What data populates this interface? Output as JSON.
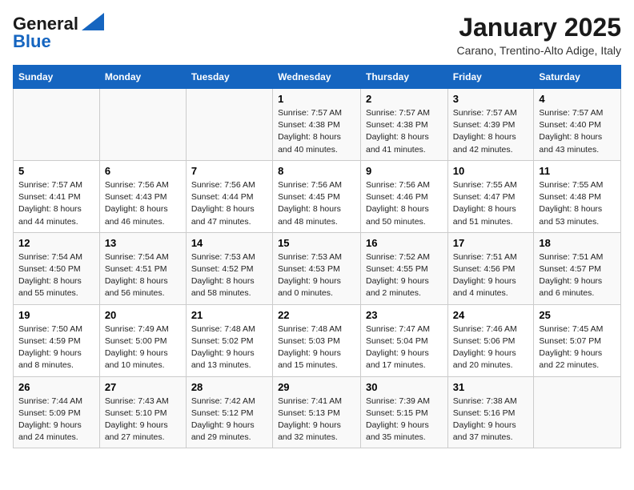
{
  "header": {
    "logo_line1": "General",
    "logo_line2": "Blue",
    "title": "January 2025",
    "subtitle": "Carano, Trentino-Alto Adige, Italy"
  },
  "weekdays": [
    "Sunday",
    "Monday",
    "Tuesday",
    "Wednesday",
    "Thursday",
    "Friday",
    "Saturday"
  ],
  "weeks": [
    [
      {
        "day": "",
        "info": ""
      },
      {
        "day": "",
        "info": ""
      },
      {
        "day": "",
        "info": ""
      },
      {
        "day": "1",
        "info": "Sunrise: 7:57 AM\nSunset: 4:38 PM\nDaylight: 8 hours\nand 40 minutes."
      },
      {
        "day": "2",
        "info": "Sunrise: 7:57 AM\nSunset: 4:38 PM\nDaylight: 8 hours\nand 41 minutes."
      },
      {
        "day": "3",
        "info": "Sunrise: 7:57 AM\nSunset: 4:39 PM\nDaylight: 8 hours\nand 42 minutes."
      },
      {
        "day": "4",
        "info": "Sunrise: 7:57 AM\nSunset: 4:40 PM\nDaylight: 8 hours\nand 43 minutes."
      }
    ],
    [
      {
        "day": "5",
        "info": "Sunrise: 7:57 AM\nSunset: 4:41 PM\nDaylight: 8 hours\nand 44 minutes."
      },
      {
        "day": "6",
        "info": "Sunrise: 7:56 AM\nSunset: 4:43 PM\nDaylight: 8 hours\nand 46 minutes."
      },
      {
        "day": "7",
        "info": "Sunrise: 7:56 AM\nSunset: 4:44 PM\nDaylight: 8 hours\nand 47 minutes."
      },
      {
        "day": "8",
        "info": "Sunrise: 7:56 AM\nSunset: 4:45 PM\nDaylight: 8 hours\nand 48 minutes."
      },
      {
        "day": "9",
        "info": "Sunrise: 7:56 AM\nSunset: 4:46 PM\nDaylight: 8 hours\nand 50 minutes."
      },
      {
        "day": "10",
        "info": "Sunrise: 7:55 AM\nSunset: 4:47 PM\nDaylight: 8 hours\nand 51 minutes."
      },
      {
        "day": "11",
        "info": "Sunrise: 7:55 AM\nSunset: 4:48 PM\nDaylight: 8 hours\nand 53 minutes."
      }
    ],
    [
      {
        "day": "12",
        "info": "Sunrise: 7:54 AM\nSunset: 4:50 PM\nDaylight: 8 hours\nand 55 minutes."
      },
      {
        "day": "13",
        "info": "Sunrise: 7:54 AM\nSunset: 4:51 PM\nDaylight: 8 hours\nand 56 minutes."
      },
      {
        "day": "14",
        "info": "Sunrise: 7:53 AM\nSunset: 4:52 PM\nDaylight: 8 hours\nand 58 minutes."
      },
      {
        "day": "15",
        "info": "Sunrise: 7:53 AM\nSunset: 4:53 PM\nDaylight: 9 hours\nand 0 minutes."
      },
      {
        "day": "16",
        "info": "Sunrise: 7:52 AM\nSunset: 4:55 PM\nDaylight: 9 hours\nand 2 minutes."
      },
      {
        "day": "17",
        "info": "Sunrise: 7:51 AM\nSunset: 4:56 PM\nDaylight: 9 hours\nand 4 minutes."
      },
      {
        "day": "18",
        "info": "Sunrise: 7:51 AM\nSunset: 4:57 PM\nDaylight: 9 hours\nand 6 minutes."
      }
    ],
    [
      {
        "day": "19",
        "info": "Sunrise: 7:50 AM\nSunset: 4:59 PM\nDaylight: 9 hours\nand 8 minutes."
      },
      {
        "day": "20",
        "info": "Sunrise: 7:49 AM\nSunset: 5:00 PM\nDaylight: 9 hours\nand 10 minutes."
      },
      {
        "day": "21",
        "info": "Sunrise: 7:48 AM\nSunset: 5:02 PM\nDaylight: 9 hours\nand 13 minutes."
      },
      {
        "day": "22",
        "info": "Sunrise: 7:48 AM\nSunset: 5:03 PM\nDaylight: 9 hours\nand 15 minutes."
      },
      {
        "day": "23",
        "info": "Sunrise: 7:47 AM\nSunset: 5:04 PM\nDaylight: 9 hours\nand 17 minutes."
      },
      {
        "day": "24",
        "info": "Sunrise: 7:46 AM\nSunset: 5:06 PM\nDaylight: 9 hours\nand 20 minutes."
      },
      {
        "day": "25",
        "info": "Sunrise: 7:45 AM\nSunset: 5:07 PM\nDaylight: 9 hours\nand 22 minutes."
      }
    ],
    [
      {
        "day": "26",
        "info": "Sunrise: 7:44 AM\nSunset: 5:09 PM\nDaylight: 9 hours\nand 24 minutes."
      },
      {
        "day": "27",
        "info": "Sunrise: 7:43 AM\nSunset: 5:10 PM\nDaylight: 9 hours\nand 27 minutes."
      },
      {
        "day": "28",
        "info": "Sunrise: 7:42 AM\nSunset: 5:12 PM\nDaylight: 9 hours\nand 29 minutes."
      },
      {
        "day": "29",
        "info": "Sunrise: 7:41 AM\nSunset: 5:13 PM\nDaylight: 9 hours\nand 32 minutes."
      },
      {
        "day": "30",
        "info": "Sunrise: 7:39 AM\nSunset: 5:15 PM\nDaylight: 9 hours\nand 35 minutes."
      },
      {
        "day": "31",
        "info": "Sunrise: 7:38 AM\nSunset: 5:16 PM\nDaylight: 9 hours\nand 37 minutes."
      },
      {
        "day": "",
        "info": ""
      }
    ]
  ]
}
